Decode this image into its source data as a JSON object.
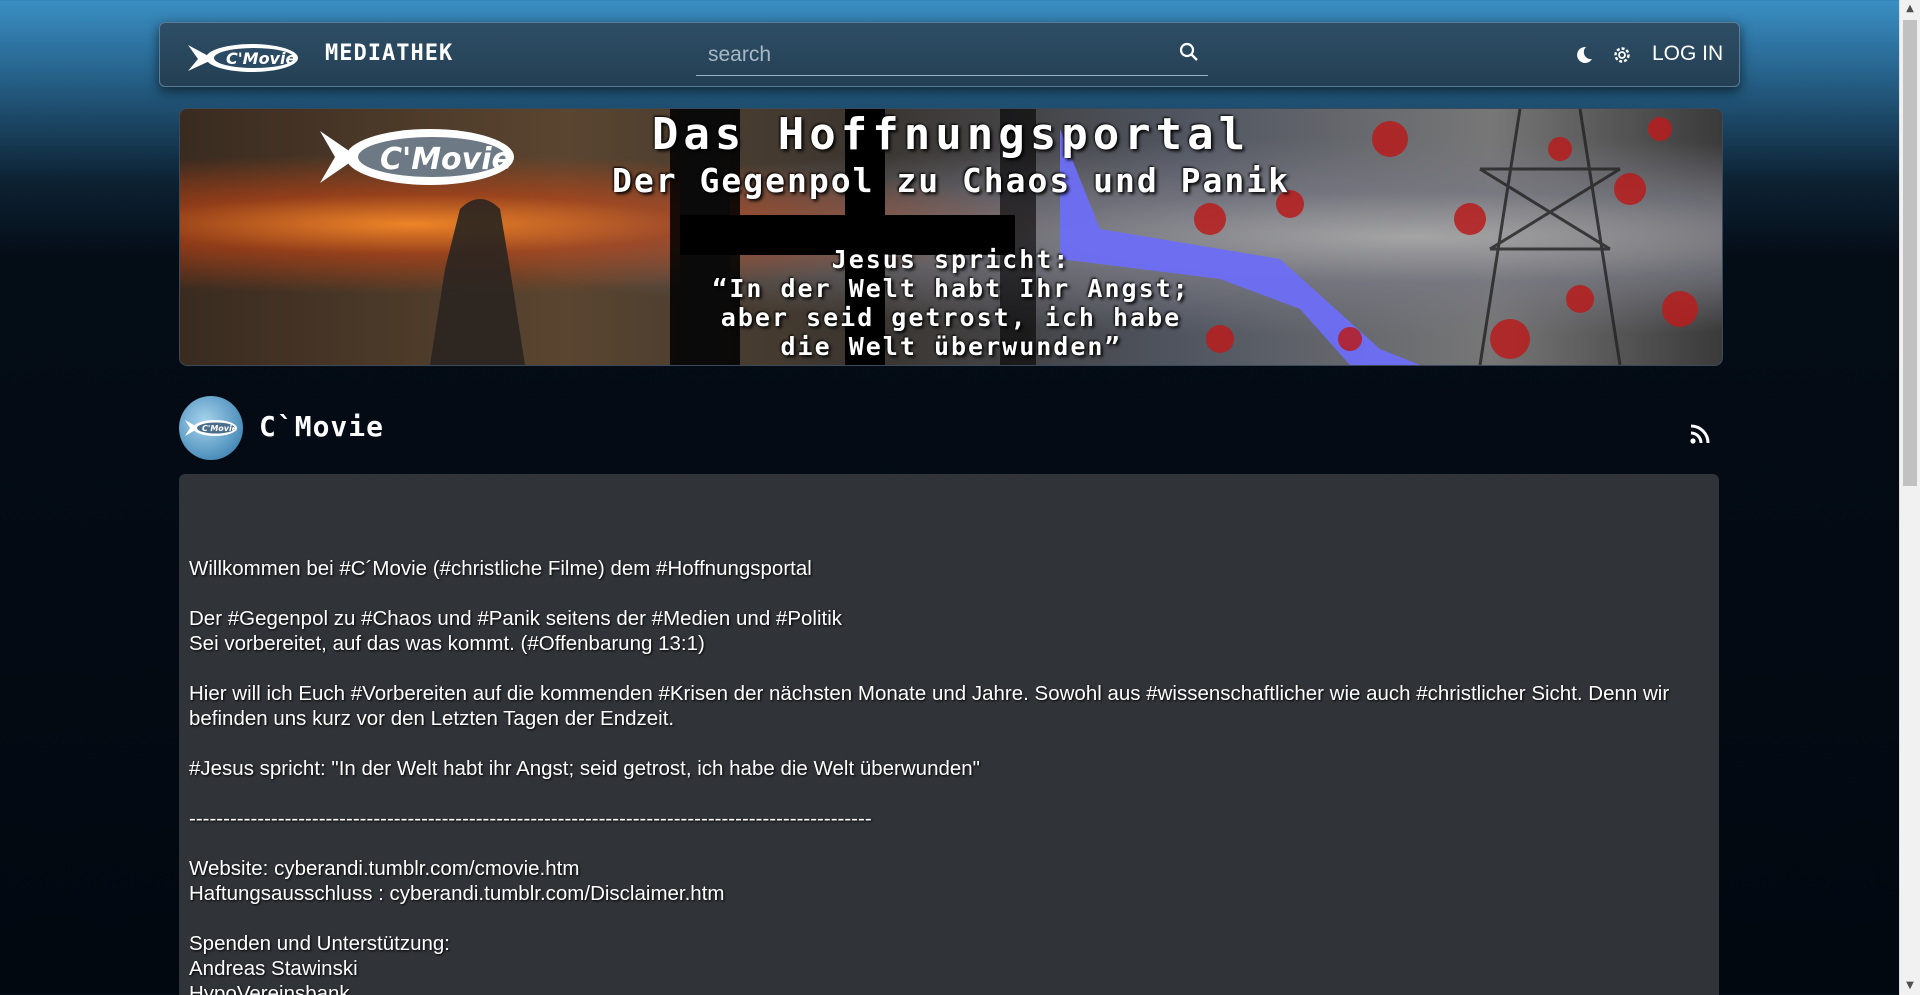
{
  "header": {
    "logo_text": "C'Movie",
    "brand": "MEDIATHEK",
    "search_placeholder": "search",
    "login_label": "LOG IN"
  },
  "banner": {
    "logo_text": "C'Movie",
    "title": "Das Hoffnungsportal",
    "subtitle": "Der Gegenpol zu Chaos und Panik",
    "quote_lines": [
      "Jesus spricht:",
      "“In der Welt habt Ihr Angst;",
      "aber seid getrost, ich habe",
      "die Welt überwunden”"
    ]
  },
  "channel": {
    "name": "C`Movie",
    "avatar_logo_text": "C'Movie"
  },
  "description": {
    "paragraphs": [
      [
        "Willkommen bei #C´Movie (#christliche  Filme) dem #Hoffnungsportal"
      ],
      [
        "Der #Gegenpol zu #Chaos und #Panik seitens der #Medien und #Politik",
        "Sei vorbereitet,  auf das was kommt. (#Offenbarung 13:1)"
      ],
      [
        "Hier will ich Euch #Vorbereiten auf die kommenden #Krisen der nächsten Monate und Jahre. Sowohl aus #wissenschaftlicher wie auch #christlicher Sicht. Denn wir befinden uns kurz vor den Letzten Tagen der Endzeit."
      ],
      [
        "#Jesus spricht: \"In der Welt habt ihr Angst; seid getrost, ich habe die Welt überwunden\""
      ],
      [
        "----------------------------------------------------------------------------------------------------"
      ],
      [
        "Website:  cyberandi.tumblr.com/cmovie.htm",
        "Haftungsausschluss :  cyberandi.tumblr.com/Disclaimer.htm"
      ],
      [
        "Spenden und Unterstützung:",
        "Andreas Stawinski",
        "HypoVereinsbank"
      ]
    ]
  },
  "colors": {
    "topbar": "#2d4e66",
    "description_bg": "#303338",
    "accent_blue": "#3a8fc4"
  },
  "icons": [
    "search-icon",
    "moon-icon",
    "gear-icon",
    "rss-icon",
    "fish-logo-icon"
  ]
}
